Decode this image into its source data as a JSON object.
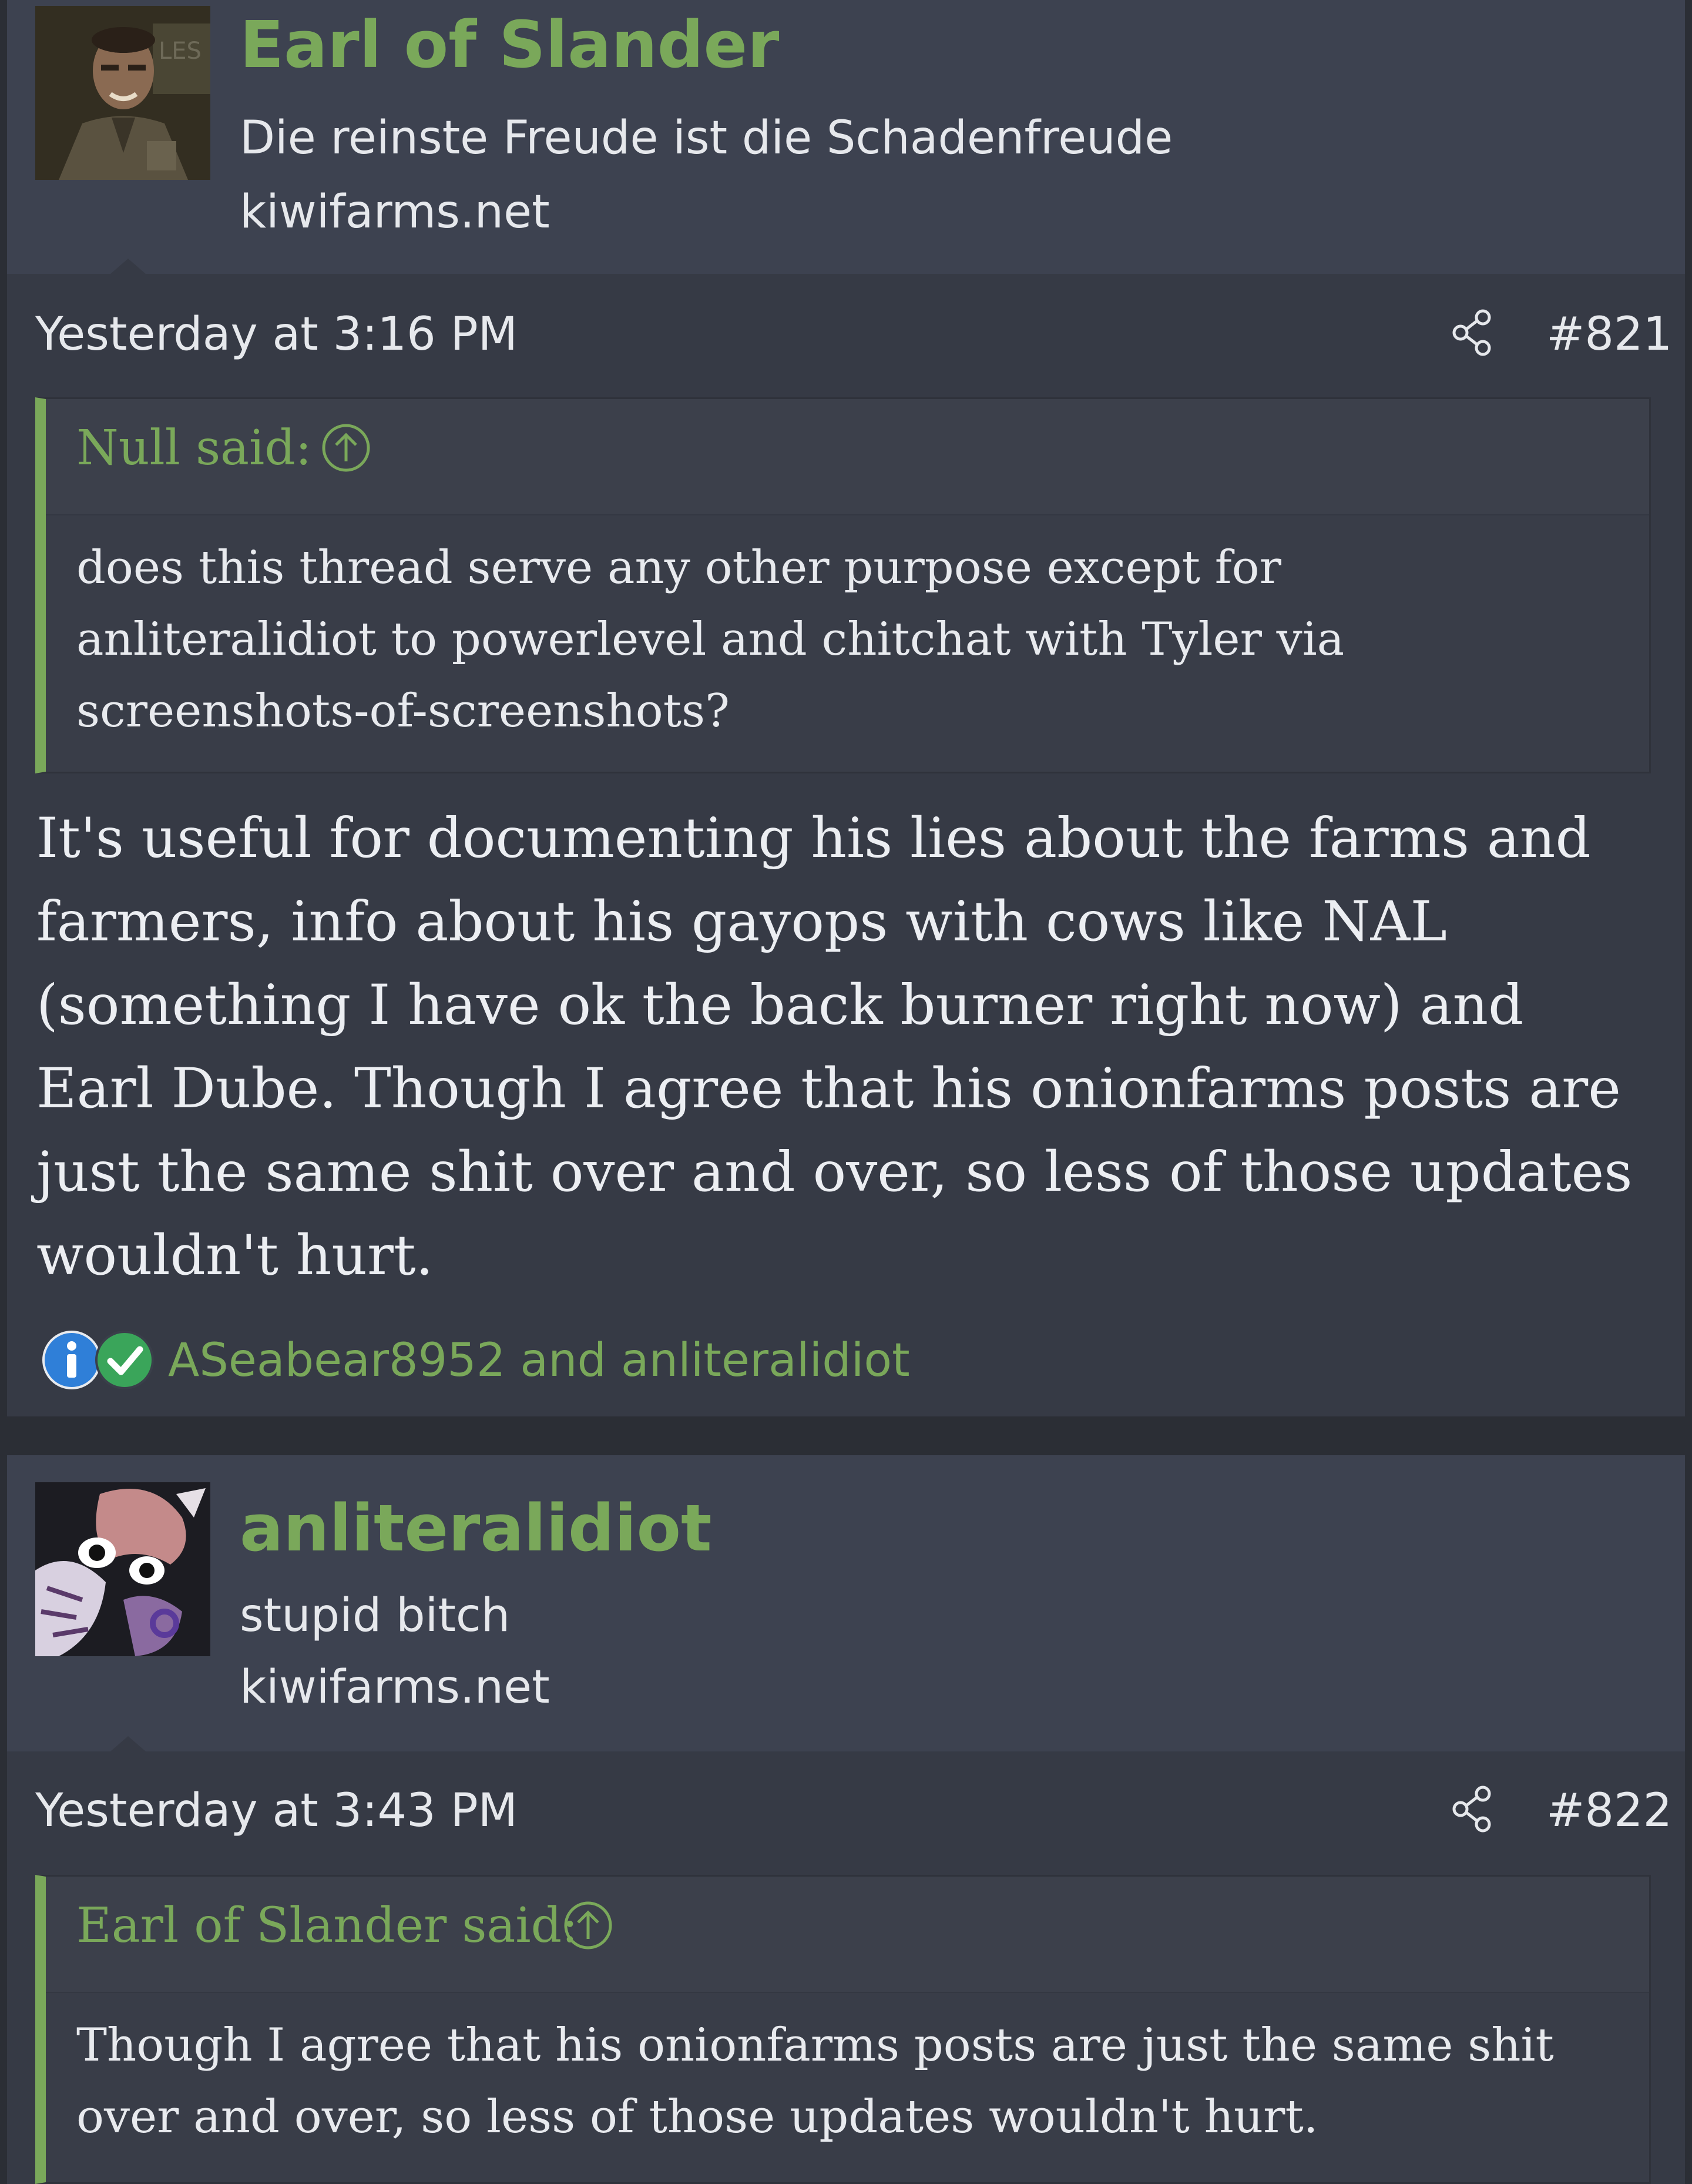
{
  "posts": [
    {
      "author": "Earl of Slander",
      "user_title": "Die reinste Freude ist die Schadenfreude",
      "site": "kiwifarms.net",
      "date": "Yesterday at 3:16 PM",
      "post_number": "#821",
      "quote": {
        "author_label": "Null said:",
        "text": "does this thread serve any other purpose except for anliteralidiot to powerlevel and chitchat with Tyler via screenshots-of-screenshots?"
      },
      "message": "It's useful for documenting his lies about the farms and farmers, info about his gayops with cows like NAL (something I have ok the back burner right now) and Earl Dube. Though I agree that his onionfarms posts are just the same shit over and over, so less of those updates wouldn't hurt.",
      "reactions": {
        "icons": [
          "informative-icon",
          "agree-check-icon"
        ],
        "names": "ASeabear8952 and anliteralidiot"
      }
    },
    {
      "author": "anliteralidiot",
      "user_title": "stupid bitch",
      "site": "kiwifarms.net",
      "date": "Yesterday at 3:43 PM",
      "post_number": "#822",
      "quote": {
        "author_label": "Earl of Slander said:",
        "text": "Though I agree that his onionfarms posts are just the same shit over and over, so less of those updates wouldn't hurt."
      }
    }
  ],
  "colors": {
    "accent_green": "#7aa85a",
    "header_bg": "#3d4250",
    "body_bg": "#363a45",
    "page_bg": "#2b2e35",
    "text": "#e6e8ec"
  }
}
